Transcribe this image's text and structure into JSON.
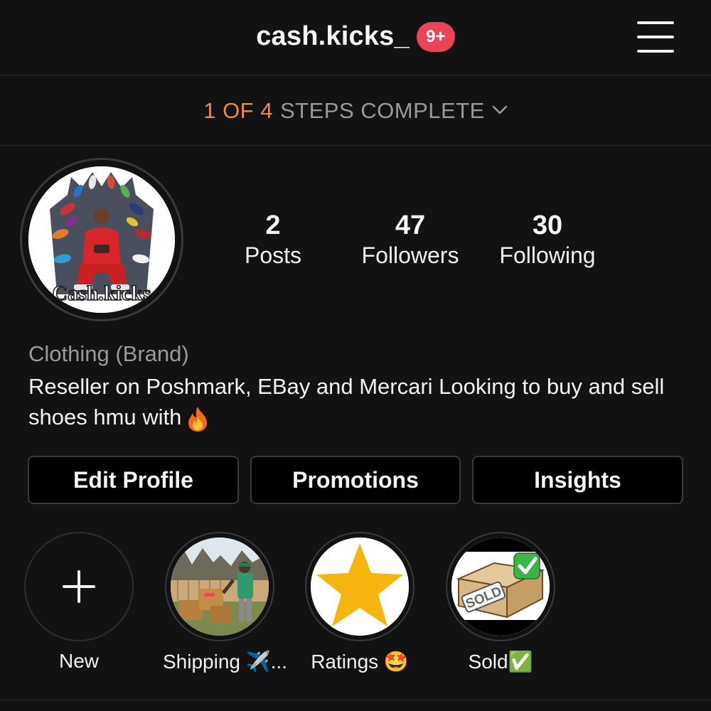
{
  "header": {
    "username": "cash.kicks_",
    "notification_badge": "9+",
    "menu_icon": "hamburger-menu-icon"
  },
  "steps": {
    "progress": "1 OF 4",
    "label": "STEPS COMPLETE",
    "icon": "chevron-down-icon"
  },
  "profile": {
    "avatar_text": "Cash.kicks",
    "stats": {
      "posts_count": "2",
      "posts_label": "Posts",
      "followers_count": "47",
      "followers_label": "Followers",
      "following_count": "30",
      "following_label": "Following"
    },
    "category": "Clothing (Brand)",
    "bio": "Reseller on Poshmark, EBay and Mercari Looking to buy and sell shoes hmu with"
  },
  "buttons": {
    "edit_profile": "Edit Profile",
    "promotions": "Promotions",
    "insights": "Insights"
  },
  "highlights": {
    "new_label": "New",
    "shipping_label": "Shipping ✈️...",
    "ratings_label": "Ratings 🤩",
    "sold_label": "Sold✅",
    "sold_badge_text": "SOLD"
  },
  "colors": {
    "background": "#121212",
    "steps_accent": "#f08a3c",
    "badge": "#e94458",
    "star": "#f6b40e"
  }
}
